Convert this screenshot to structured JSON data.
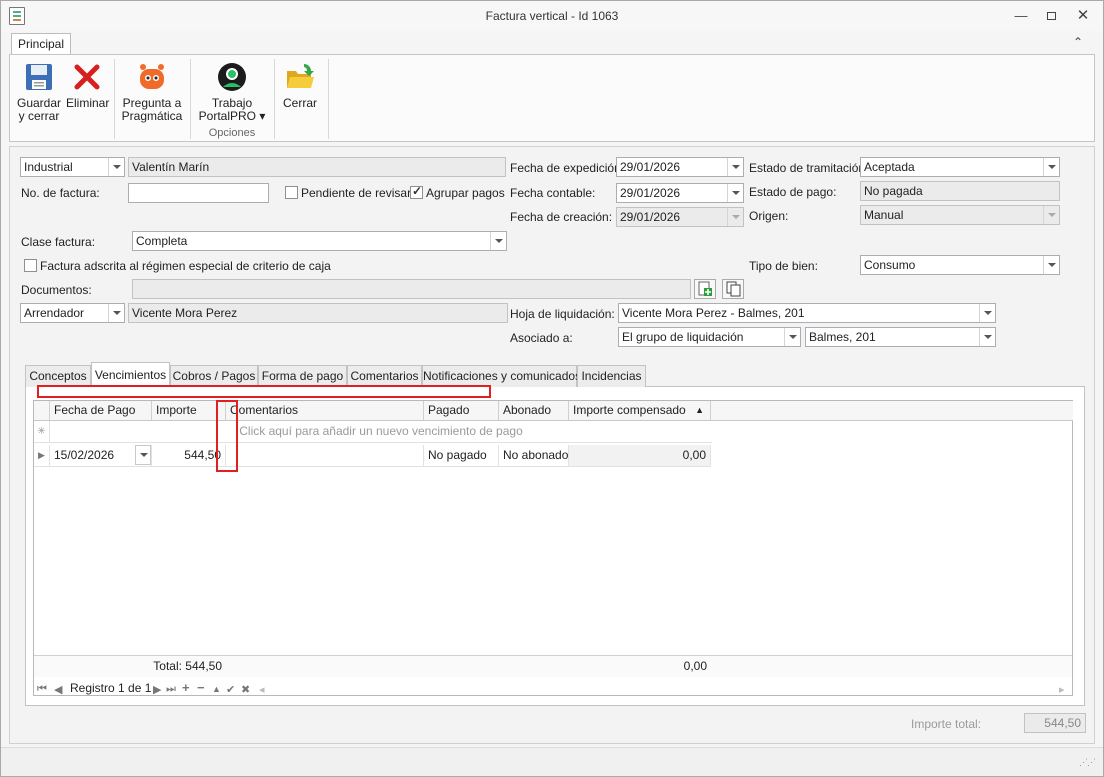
{
  "window": {
    "title": "Factura vertical - Id 1063"
  },
  "ribbon": {
    "tab": "Principal",
    "buttons": {
      "save": "Guardar\ny cerrar",
      "delete": "Eliminar",
      "ask": "Pregunta a\nPragmática",
      "portal": "Trabajo\nPortalPRO ▾",
      "close": "Cerrar"
    },
    "group_label": "Opciones"
  },
  "form": {
    "party_type": "Industrial",
    "party_name": "Valentín Marín",
    "invoice_no_label": "No. de factura:",
    "invoice_no": "",
    "pending_label": "Pendiente de revisar",
    "group_payments_label": "Agrupar pagos",
    "issue_date_label": "Fecha de expedición:",
    "issue_date": "29/01/2026",
    "accounting_date_label": "Fecha contable:",
    "accounting_date": "29/01/2026",
    "creation_date_label": "Fecha de creación:",
    "creation_date": "29/01/2026",
    "processing_state_label": "Estado de tramitación:",
    "processing_state": "Aceptada",
    "payment_state_label": "Estado de pago:",
    "payment_state": "No pagada",
    "origin_label": "Origen:",
    "origin": "Manual",
    "invoice_class_label": "Clase factura:",
    "invoice_class": "Completa",
    "cash_regime_label": "Factura adscrita al régimen especial de criterio de caja",
    "good_type_label": "Tipo de bien:",
    "good_type": "Consumo",
    "documents_label": "Documentos:",
    "documents": "",
    "lessor_type": "Arrendador",
    "lessor_name": "Vicente Mora Perez",
    "settlement_sheet_label": "Hoja de liquidación:",
    "settlement_sheet": "Vicente Mora Perez - Balmes, 201",
    "associated_label": "Asociado a:",
    "associated_type": "El grupo de liquidación",
    "associated_value": "Balmes, 201",
    "total_label": "Importe total:",
    "total": "544,50"
  },
  "tabs": [
    "Conceptos",
    "Vencimientos",
    "Cobros / Pagos",
    "Forma de pago",
    "Comentarios",
    "Notificaciones y comunicados",
    "Incidencias"
  ],
  "grid": {
    "headers": [
      "Fecha de Pago",
      "Importe",
      "Comentarios",
      "Pagado",
      "Abonado",
      "Importe compensado"
    ],
    "new_row_hint": "Click aquí para añadir un nuevo vencimiento de pago",
    "rows": [
      {
        "date": "15/02/2026",
        "amount": "544,50",
        "comments": "",
        "paid": "No pagado",
        "credited": "No abonado",
        "compensated": "0,00"
      }
    ],
    "footer_total": "Total: 544,50",
    "footer_compensated": "0,00",
    "record_label": "Registro 1 de 1"
  }
}
